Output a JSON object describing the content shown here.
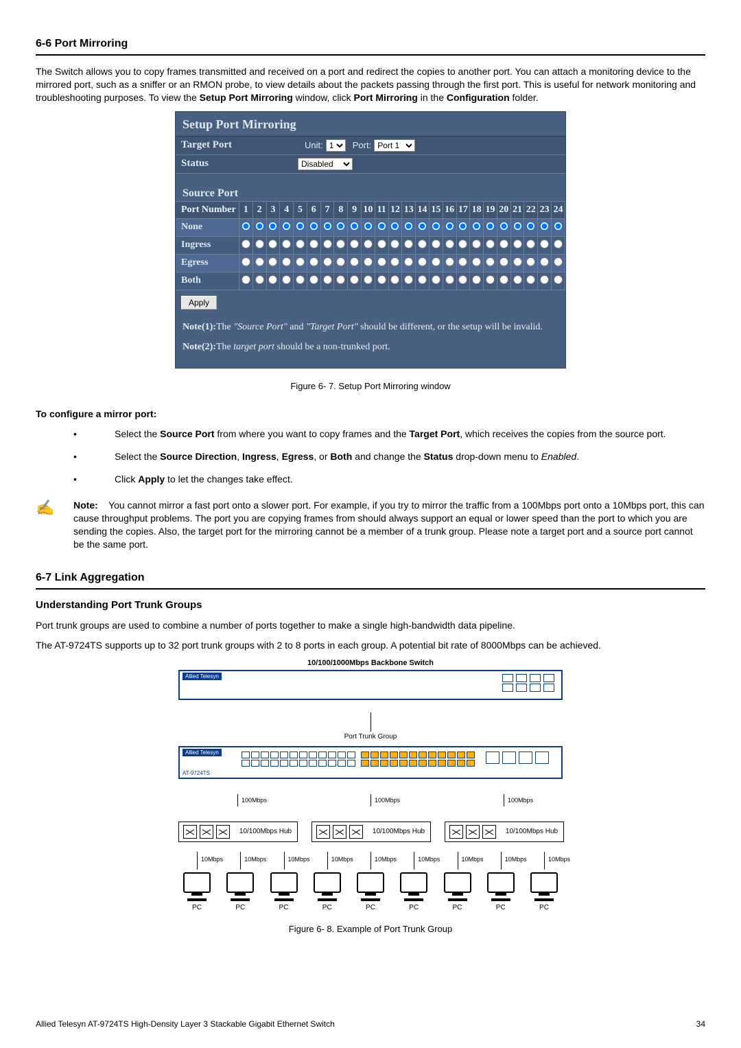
{
  "sections": {
    "s66": {
      "heading": "6-6 Port Mirroring",
      "intro_segments": [
        {
          "t": "The Switch allows you to copy frames transmitted and received on a port and redirect the copies to another port. You can attach a monitoring device to the mirrored port, such as a sniffer or an RMON probe, to view details about the packets passing through the first port. This is useful for network monitoring and troubleshooting purposes. To view the "
        },
        {
          "t": "Setup Port Mirroring",
          "b": true
        },
        {
          "t": " window, click "
        },
        {
          "t": "Port Mirroring",
          "b": true
        },
        {
          "t": " in the "
        },
        {
          "t": "Configuration",
          "b": true
        },
        {
          "t": " folder."
        }
      ]
    },
    "s67": {
      "heading": "6-7 Link Aggregation",
      "sub": "Understanding Port Trunk Groups",
      "p1": "Port trunk groups are used to combine a number of ports together to make a single high-bandwidth data pipeline.",
      "p2": "The AT-9724TS supports up to 32 port trunk groups with 2 to 8 ports in each group. A potential bit rate of 8000Mbps can be achieved."
    }
  },
  "mirror_window": {
    "title": "Setup Port Mirroring",
    "target_label": "Target Port",
    "unit_label": "Unit:",
    "unit_value": "1",
    "port_label": "Port:",
    "port_value": "Port 1",
    "status_label": "Status",
    "status_value": "Disabled",
    "source_header": "Source Port",
    "port_number_label": "Port Number",
    "ports": [
      "1",
      "2",
      "3",
      "4",
      "5",
      "6",
      "7",
      "8",
      "9",
      "10",
      "11",
      "12",
      "13",
      "14",
      "15",
      "16",
      "17",
      "18",
      "19",
      "20",
      "21",
      "22",
      "23",
      "24"
    ],
    "rows": [
      "None",
      "Ingress",
      "Egress",
      "Both"
    ],
    "apply": "Apply",
    "note1_segments": [
      {
        "t": "Note(1):",
        "b": true
      },
      {
        "t": "The "
      },
      {
        "t": "\"Source Port\"",
        "i": true
      },
      {
        "t": " and "
      },
      {
        "t": "\"Target Port\"",
        "i": true
      },
      {
        "t": " should be different, or the setup will be invalid."
      }
    ],
    "note2_segments": [
      {
        "t": "Note(2):",
        "b": true
      },
      {
        "t": "The "
      },
      {
        "t": "target port",
        "i": true
      },
      {
        "t": " should be a non-trunked port."
      }
    ]
  },
  "captions": {
    "fig67": "Figure 6- 7. Setup Port Mirroring window",
    "fig68": "Figure 6- 8. Example of Port Trunk Group"
  },
  "config_steps": {
    "heading": "To configure a mirror port:",
    "items": [
      [
        {
          "t": "Select the "
        },
        {
          "t": "Source Port",
          "b": true
        },
        {
          "t": " from where you want to copy frames and the "
        },
        {
          "t": "Target Port",
          "b": true
        },
        {
          "t": ", which receives the copies from the source port."
        }
      ],
      [
        {
          "t": "Select the "
        },
        {
          "t": "Source Direction",
          "b": true
        },
        {
          "t": ", "
        },
        {
          "t": "Ingress",
          "b": true
        },
        {
          "t": ", "
        },
        {
          "t": "Egress",
          "b": true
        },
        {
          "t": ", or "
        },
        {
          "t": "Both",
          "b": true
        },
        {
          "t": " and change the "
        },
        {
          "t": "Status",
          "b": true
        },
        {
          "t": " drop-down menu to "
        },
        {
          "t": "Enabled",
          "i": true
        },
        {
          "t": "."
        }
      ],
      [
        {
          "t": "Click "
        },
        {
          "t": "Apply",
          "b": true
        },
        {
          "t": " to let the changes take effect."
        }
      ]
    ]
  },
  "note_block": {
    "label": "Note:",
    "text": "You cannot mirror a fast port onto a slower port. For example, if you try to mirror the traffic from a 100Mbps port onto a 10Mbps port, this can cause throughput problems. The port you are copying frames from should always support an equal or lower speed than the port to which you are sending the copies. Also, the target port for the mirroring cannot be a member of a trunk group. Please note a target port and a source port cannot be the same port."
  },
  "diagram": {
    "backbone_label": "10/100/1000Mbps Backbone Switch",
    "trunk_label": "Port Trunk Group",
    "brand": "Allied Telesyn",
    "switch_model": "AT-9724TS",
    "link100": "100Mbps",
    "hub_label": "10/100Mbps Hub",
    "link10": "10Mbps",
    "pc": "PC"
  },
  "footer": {
    "left": "Allied Telesyn AT-9724TS High-Density Layer 3 Stackable Gigabit Ethernet Switch",
    "right": "34"
  }
}
